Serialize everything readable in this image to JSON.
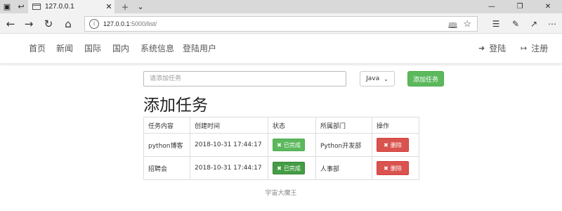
{
  "browser": {
    "tab_title": "127.0.0.1",
    "url_host": "127.0.0.1",
    "url_path": ":5000/list/"
  },
  "nav": {
    "items": [
      "首页",
      "新闻",
      "国际",
      "国内",
      "系统信息",
      "登陆用户"
    ],
    "login": "登陆",
    "register": "注册"
  },
  "form": {
    "placeholder": "请添加任务",
    "dept_selected": "Java",
    "add_label": "添加任务"
  },
  "heading": "添加任务",
  "table": {
    "headers": [
      "任务内容",
      "创建时间",
      "状态",
      "所属部门",
      "操作"
    ],
    "rows": [
      {
        "content": "python博客",
        "created": "2018-10-31 17:44:17",
        "status": "已完成",
        "dept": "Python开发部",
        "action": "删除"
      },
      {
        "content": "招聘会",
        "created": "2018-10-31 17:44:17",
        "status": "已完成",
        "dept": "人事部",
        "action": "删除"
      }
    ]
  },
  "footer": "宇宙大魔王",
  "colors": {
    "success": "#5cb85c",
    "danger": "#d9534f"
  }
}
